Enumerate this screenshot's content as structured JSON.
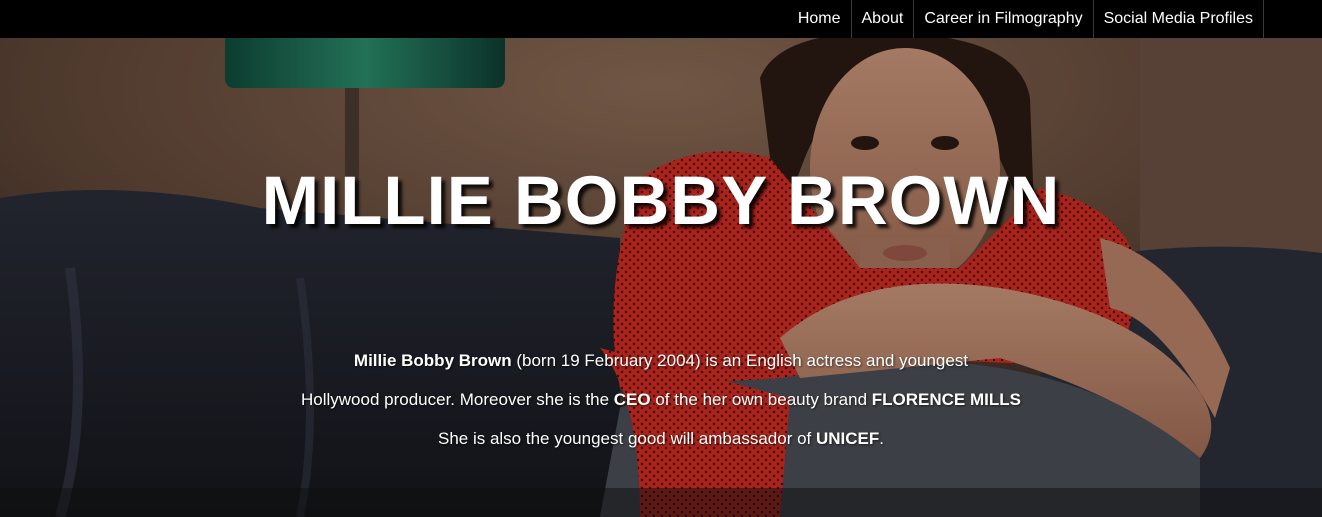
{
  "nav": {
    "items": [
      {
        "label": "Home"
      },
      {
        "label": "About"
      },
      {
        "label": "Career in Filmography"
      },
      {
        "label": "Social Media Profiles"
      }
    ]
  },
  "hero": {
    "title": "MILLIE BOBBY BROWN",
    "line1": {
      "name": "Millie Bobby Brown",
      "rest": " (born 19 February 2004) is an English actress and youngest"
    },
    "line2": {
      "pre": "Hollywood producer. Moreover she is the ",
      "ceo": "CEO",
      "mid": " of the her own beauty brand ",
      "brand": "FLORENCE MILLS"
    },
    "line3": {
      "pre": "She is also the youngest good will ambassador of ",
      "org": "UNICEF",
      "post": "."
    }
  },
  "colors": {
    "nav_bg": "#000000",
    "text": "#ffffff",
    "dress_red": "#d32a1f"
  }
}
